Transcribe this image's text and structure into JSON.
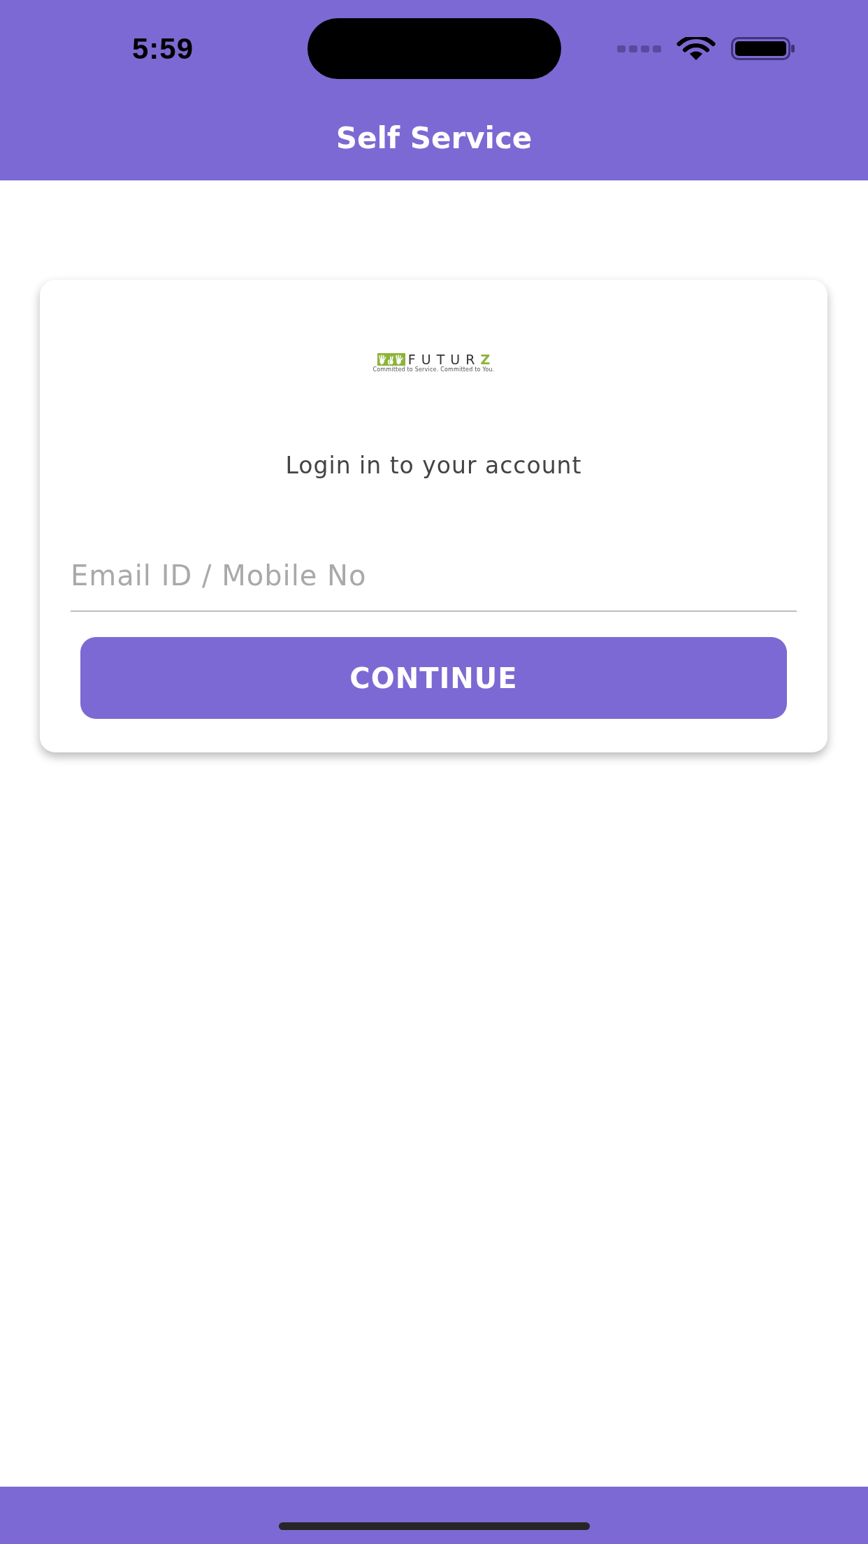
{
  "status_bar": {
    "time": "5:59"
  },
  "header": {
    "title": "Self Service"
  },
  "login_card": {
    "logo": {
      "name": "FUTURZ",
      "tagline": "Committed to Service. Committed to You."
    },
    "heading": "Login in to your account",
    "email_field": {
      "placeholder": "Email ID / Mobile No"
    },
    "continue_button": "CONTINUE"
  }
}
